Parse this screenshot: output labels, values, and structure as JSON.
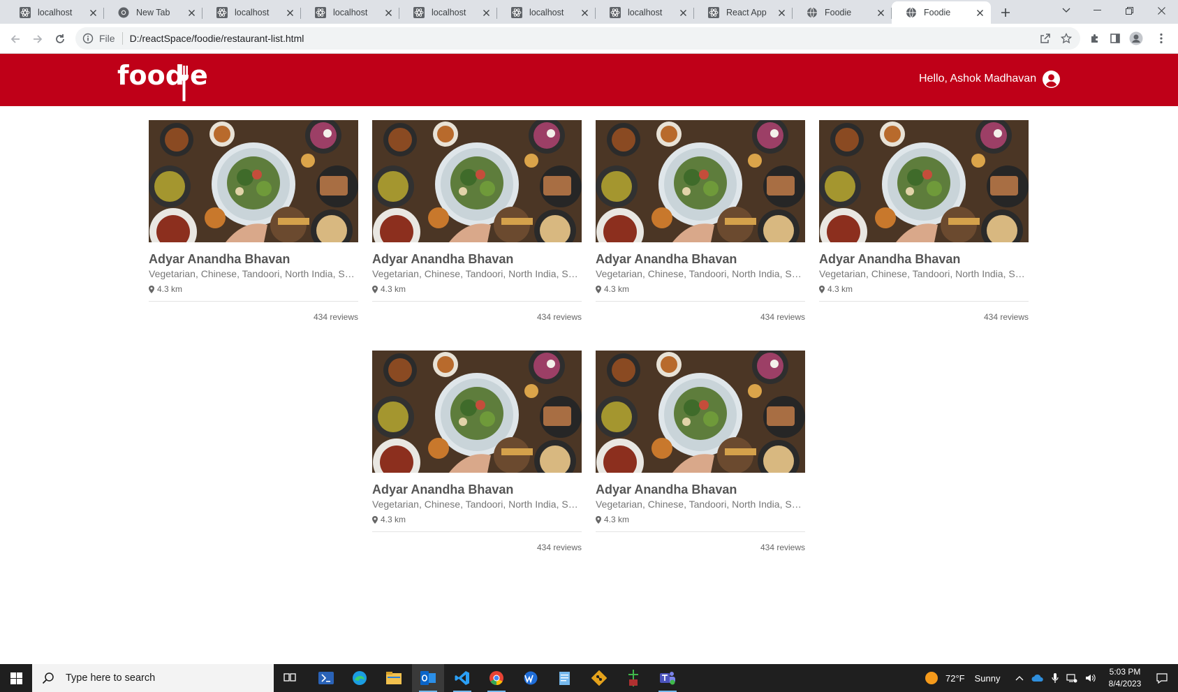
{
  "browser": {
    "tabs": [
      {
        "title": "localhost",
        "icon": "react-favicon"
      },
      {
        "title": "New Tab",
        "icon": "chrome-favicon"
      },
      {
        "title": "localhost",
        "icon": "react-favicon"
      },
      {
        "title": "localhost",
        "icon": "react-favicon"
      },
      {
        "title": "localhost",
        "icon": "react-favicon"
      },
      {
        "title": "localhost",
        "icon": "react-favicon"
      },
      {
        "title": "localhost",
        "icon": "react-favicon"
      },
      {
        "title": "React App",
        "icon": "react-favicon"
      },
      {
        "title": "Foodie",
        "icon": "globe-favicon"
      },
      {
        "title": "Foodie",
        "icon": "globe-favicon",
        "active": true
      }
    ],
    "address": {
      "scheme_label": "File",
      "url": "D:/reactSpace/foodie/restaurant-list.html"
    }
  },
  "app": {
    "brand": {
      "logo_text": "foodie",
      "color": "#bf0018"
    },
    "header": {
      "greeting": "Hello, Ashok Madhavan"
    },
    "restaurants": [
      {
        "name": "Adyar Anandha Bhavan",
        "cuisines": "Vegetarian, Chinese, Tandoori, North India, South Indian",
        "distance": "4.3 km",
        "reviews": "434 reviews"
      },
      {
        "name": "Adyar Anandha Bhavan",
        "cuisines": "Vegetarian, Chinese, Tandoori, North India, South Indian",
        "distance": "4.3 km",
        "reviews": "434 reviews"
      },
      {
        "name": "Adyar Anandha Bhavan",
        "cuisines": "Vegetarian, Chinese, Tandoori, North India, South Indian",
        "distance": "4.3 km",
        "reviews": "434 reviews"
      },
      {
        "name": "Adyar Anandha Bhavan",
        "cuisines": "Vegetarian, Chinese, Tandoori, North India, South Indian",
        "distance": "4.3 km",
        "reviews": "434 reviews"
      },
      {
        "name": "Adyar Anandha Bhavan",
        "cuisines": "Vegetarian, Chinese, Tandoori, North India, South Indian",
        "distance": "4.3 km",
        "reviews": "434 reviews"
      },
      {
        "name": "Adyar Anandha Bhavan",
        "cuisines": "Vegetarian, Chinese, Tandoori, North India, South Indian",
        "distance": "4.3 km",
        "reviews": "434 reviews"
      }
    ]
  },
  "taskbar": {
    "search_placeholder": "Type here to search",
    "apps": [
      "task-view-icon",
      "powershell-icon",
      "edge-icon",
      "file-explorer-icon",
      "outlook-icon",
      "vscode-icon",
      "chrome-icon",
      "webex-icon",
      "notepad-icon",
      "git-icon",
      "git-extensions-icon",
      "teams-icon"
    ],
    "weather": {
      "temp": "72°F",
      "condition": "Sunny"
    },
    "time": "5:03 PM",
    "date": "8/4/2023"
  }
}
